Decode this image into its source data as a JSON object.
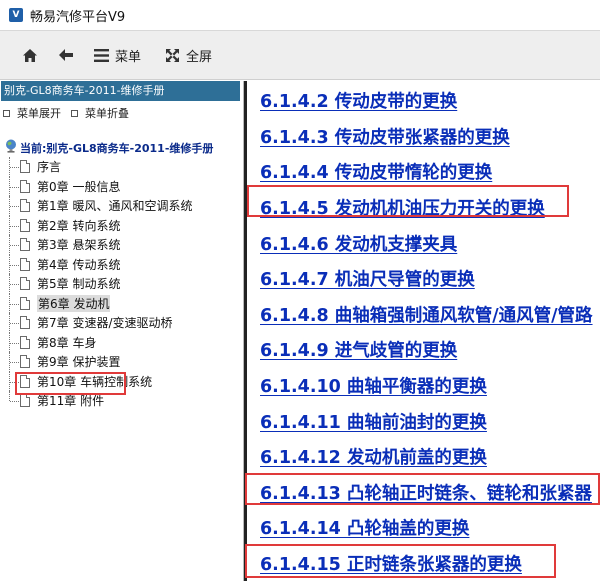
{
  "window": {
    "title": "畅易汽修平台V9",
    "app_icon_glyph": "V"
  },
  "toolbar": {
    "home_icon": "home-icon",
    "back_icon": "back-arrow-icon",
    "menu_label": "菜单",
    "fullscreen_label": "全屏"
  },
  "left_panel": {
    "header": "别克-GL8商务车-2011-维修手册",
    "expand_label": "菜单展开",
    "collapse_label": "菜单折叠",
    "tree_root": "当前:别克-GL8商务车-2011-维修手册",
    "items": [
      {
        "label": "序言"
      },
      {
        "label": "第0章 一般信息"
      },
      {
        "label": "第1章 暖风、通风和空调系统"
      },
      {
        "label": "第2章 转向系统"
      },
      {
        "label": "第3章 悬架系统"
      },
      {
        "label": "第4章 传动系统"
      },
      {
        "label": "第5章 制动系统"
      },
      {
        "label": "第6章 发动机",
        "selected": true
      },
      {
        "label": "第7章 变速器/变速驱动桥"
      },
      {
        "label": "第8章 车身"
      },
      {
        "label": "第9章 保护装置"
      },
      {
        "label": "第10章 车辆控制系统"
      },
      {
        "label": "第11章 附件"
      }
    ]
  },
  "content": {
    "links": [
      {
        "text": "6.1.4.2 传动皮带的更换"
      },
      {
        "text": "6.1.4.3 传动皮带张紧器的更换"
      },
      {
        "text": "6.1.4.4 传动皮带惰轮的更换"
      },
      {
        "text": "6.1.4.5 发动机机油压力开关的更换",
        "highlighted": true
      },
      {
        "text": "6.1.4.6 发动机支撑夹具"
      },
      {
        "text": "6.1.4.7 机油尺导管的更换"
      },
      {
        "text": "6.1.4.8 曲轴箱强制通风软管/通风管/管路"
      },
      {
        "text": "6.1.4.9 进气歧管的更换"
      },
      {
        "text": "6.1.4.10 曲轴平衡器的更换"
      },
      {
        "text": "6.1.4.11 曲轴前油封的更换"
      },
      {
        "text": "6.1.4.12 发动机前盖的更换"
      },
      {
        "text": "6.1.4.13 凸轮轴正时链条、链轮和张紧器",
        "highlighted": true
      },
      {
        "text": "6.1.4.14 凸轮轴盖的更换"
      },
      {
        "text": "6.1.4.15 正时链条张紧器的更换",
        "highlighted": true
      }
    ]
  },
  "colors": {
    "link": "#0a2eb8",
    "highlight_box": "#e03a3a",
    "left_header_bg": "#2e6f97",
    "toolbar_bg": "#eeeeee"
  }
}
